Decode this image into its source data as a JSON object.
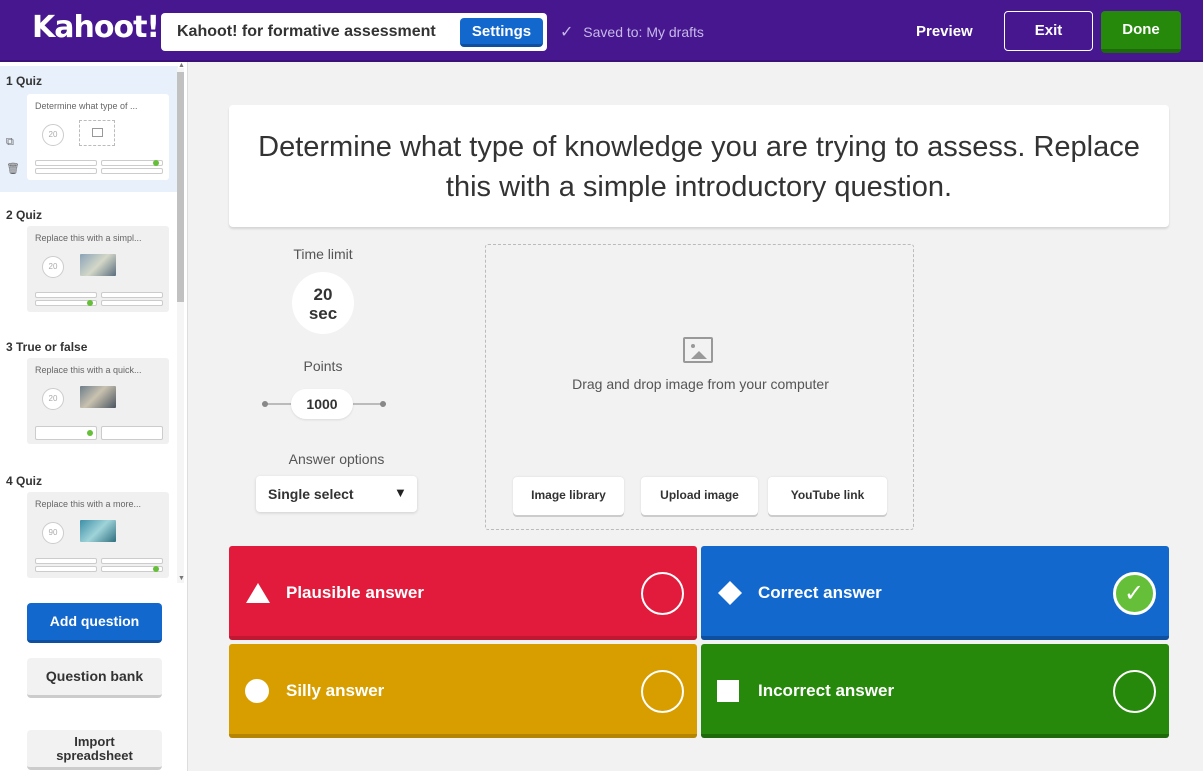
{
  "header": {
    "logo": "Kahoot!",
    "quiz_title": "Kahoot! for formative assessment",
    "settings_label": "Settings",
    "saved_status": "Saved to: My drafts",
    "preview_label": "Preview",
    "exit_label": "Exit",
    "done_label": "Done"
  },
  "sidebar": {
    "questions": [
      {
        "label": "1  Quiz",
        "snippet": "Determine what type of ...",
        "timer": "20"
      },
      {
        "label": "2  Quiz",
        "snippet": "Replace this with a simpl...",
        "timer": "20"
      },
      {
        "label": "3  True or false",
        "snippet": "Replace this with a quick...",
        "timer": "20"
      },
      {
        "label": "4  Quiz",
        "snippet": "Replace this with a more...",
        "timer": "90"
      }
    ],
    "add_question_label": "Add question",
    "question_bank_label": "Question bank",
    "import_label_1": "Import",
    "import_label_2": "spreadsheet"
  },
  "editor": {
    "question_text": "Determine what type of knowledge you are trying to assess. Replace this with a simple introductory question.",
    "time_limit_label": "Time limit",
    "time_limit_value": "20",
    "time_limit_unit": "sec",
    "points_label": "Points",
    "points_value": "1000",
    "answer_options_label": "Answer options",
    "answer_options_value": "Single select",
    "media_prompt": "Drag and drop image from your computer",
    "media_buttons": [
      "Image library",
      "Upload image",
      "YouTube link"
    ]
  },
  "answers": [
    {
      "text": "Plausible answer",
      "color": "#e21b3c",
      "shape": "triangle-icon",
      "correct": false
    },
    {
      "text": "Correct answer",
      "color": "#1368ce",
      "shape": "diamond-icon",
      "correct": true
    },
    {
      "text": "Silly answer",
      "color": "#d89e00",
      "shape": "circle-icon",
      "correct": false
    },
    {
      "text": "Incorrect answer",
      "color": "#26890c",
      "shape": "square-icon",
      "correct": false
    }
  ]
}
